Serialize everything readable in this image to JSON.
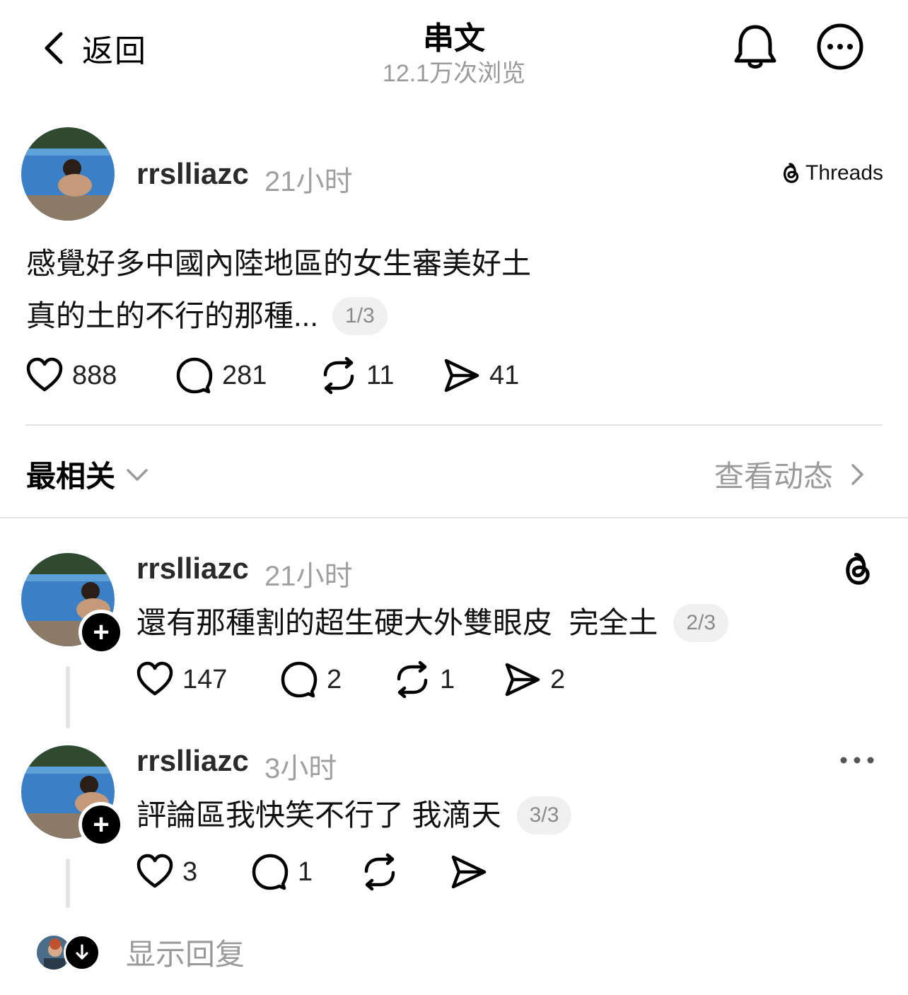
{
  "header": {
    "back_label": "返回",
    "title": "串文",
    "views": "12.1万次浏览"
  },
  "main_post": {
    "username": "rrslliazc",
    "time": "21小时",
    "source_label": "Threads",
    "line1": "感覺好多中國內陸地區的女生審美好土",
    "line2": "真的土的不行的那種...",
    "pager": "1/3",
    "likes": "888",
    "comments": "281",
    "reposts": "11",
    "shares": "41"
  },
  "sort": {
    "label": "最相关",
    "activity_label": "查看动态"
  },
  "replies": [
    {
      "username": "rrslliazc",
      "time": "21小时",
      "text": "還有那種割的超生硬大外雙眼皮  完全土",
      "pager": "2/3",
      "likes": "147",
      "comments": "2",
      "reposts": "1",
      "shares": "2"
    },
    {
      "username": "rrslliazc",
      "time": "3小时",
      "text": "評論區我快笑不行了 我滴天",
      "pager": "3/3",
      "likes": "3",
      "comments": "1"
    }
  ],
  "footer": {
    "show_replies_label": "显示回复"
  },
  "icons": [
    "chevron-left-icon",
    "bell-icon",
    "more-icon",
    "threads-logo-icon",
    "heart-icon",
    "comment-icon",
    "repost-icon",
    "share-icon",
    "chevron-down-icon",
    "chevron-right-icon",
    "plus-icon",
    "arrow-down-icon"
  ],
  "colors": {
    "muted": "#9a9a9a",
    "divider": "#e3e3e3",
    "pager_bg": "#f0f0f0"
  }
}
